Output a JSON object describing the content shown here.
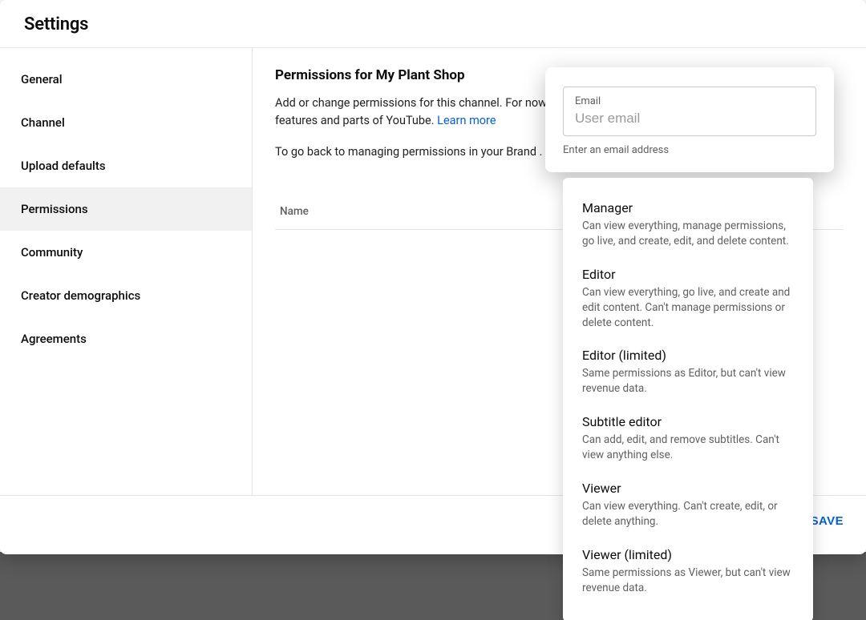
{
  "header": {
    "title": "Settings"
  },
  "sidebar": {
    "items": [
      {
        "label": "General",
        "active": false
      },
      {
        "label": "Channel",
        "active": false
      },
      {
        "label": "Upload defaults",
        "active": false
      },
      {
        "label": "Permissions",
        "active": true
      },
      {
        "label": "Community",
        "active": false
      },
      {
        "label": "Creator demographics",
        "active": false
      },
      {
        "label": "Agreements",
        "active": false
      }
    ]
  },
  "main": {
    "heading": "Permissions for My Plant Shop",
    "desc_line1_pre": "Add or change permissions for this channel. For now",
    "desc_line2": "features and parts of YouTube. ",
    "learn_more": "Learn more",
    "desc_line3": "To go back to managing permissions in your Brand .",
    "table_name_header": "Name"
  },
  "invite": {
    "email_label": "Email",
    "email_placeholder": "User email",
    "email_value": "",
    "helper": "Enter an email address"
  },
  "roles": [
    {
      "title": "Manager",
      "desc": "Can view everything, manage permissions, go live, and create, edit, and delete content."
    },
    {
      "title": "Editor",
      "desc": "Can view everything, go live, and create and edit content. Can't manage permissions or delete content."
    },
    {
      "title": "Editor (limited)",
      "desc": "Same permissions as Editor, but can't view revenue data."
    },
    {
      "title": "Subtitle editor",
      "desc": "Can add, edit, and remove subtitles. Can't view anything else."
    },
    {
      "title": "Viewer",
      "desc": "Can view everything. Can't create, edit, or delete anything."
    },
    {
      "title": "Viewer (limited)",
      "desc": "Same permissions as Viewer, but can't view revenue data."
    }
  ],
  "footer": {
    "save": "SAVE"
  }
}
